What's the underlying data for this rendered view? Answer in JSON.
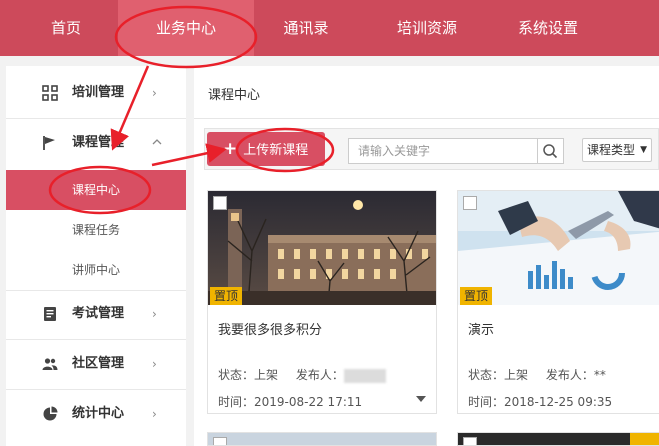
{
  "topnav": {
    "items": [
      {
        "label": "首页"
      },
      {
        "label": "业务中心"
      },
      {
        "label": "通讯录"
      },
      {
        "label": "培训资源"
      },
      {
        "label": "系统设置"
      }
    ]
  },
  "sidebar": {
    "groups": [
      {
        "label": "培训管理",
        "icon": "grid-icon",
        "chevron": "›"
      },
      {
        "label": "课程管理",
        "icon": "flag-icon",
        "chevron": "^",
        "children": [
          {
            "label": "课程中心"
          },
          {
            "label": "课程任务"
          },
          {
            "label": "讲师中心"
          }
        ]
      },
      {
        "label": "考试管理",
        "icon": "document-icon",
        "chevron": "›"
      },
      {
        "label": "社区管理",
        "icon": "users-icon",
        "chevron": "›"
      },
      {
        "label": "统计中心",
        "icon": "pie-chart-icon",
        "chevron": "›"
      }
    ]
  },
  "main": {
    "breadcrumb": "课程中心",
    "toolbar": {
      "upload_label": "上传新课程",
      "upload_plus": "+",
      "search_placeholder": "请输入关键字",
      "type_select": "课程类型"
    },
    "cards": [
      {
        "badge": "置顶",
        "title": "我要很多很多积分",
        "status_label": "状态：",
        "status": "上架",
        "publisher_label": "发布人：",
        "publisher": "",
        "time": "时间：2019-08-22 17:11"
      },
      {
        "badge": "置顶",
        "title": "演示",
        "status_label": "状态：",
        "status": "上架",
        "publisher_label": "发布人：",
        "publisher": "**",
        "time": "时间：2018-12-25 09:35"
      }
    ]
  },
  "colors": {
    "brand": "#cd4a5b",
    "active": "#d84f63",
    "badge": "#f0b400",
    "annotation": "#e8202a"
  }
}
